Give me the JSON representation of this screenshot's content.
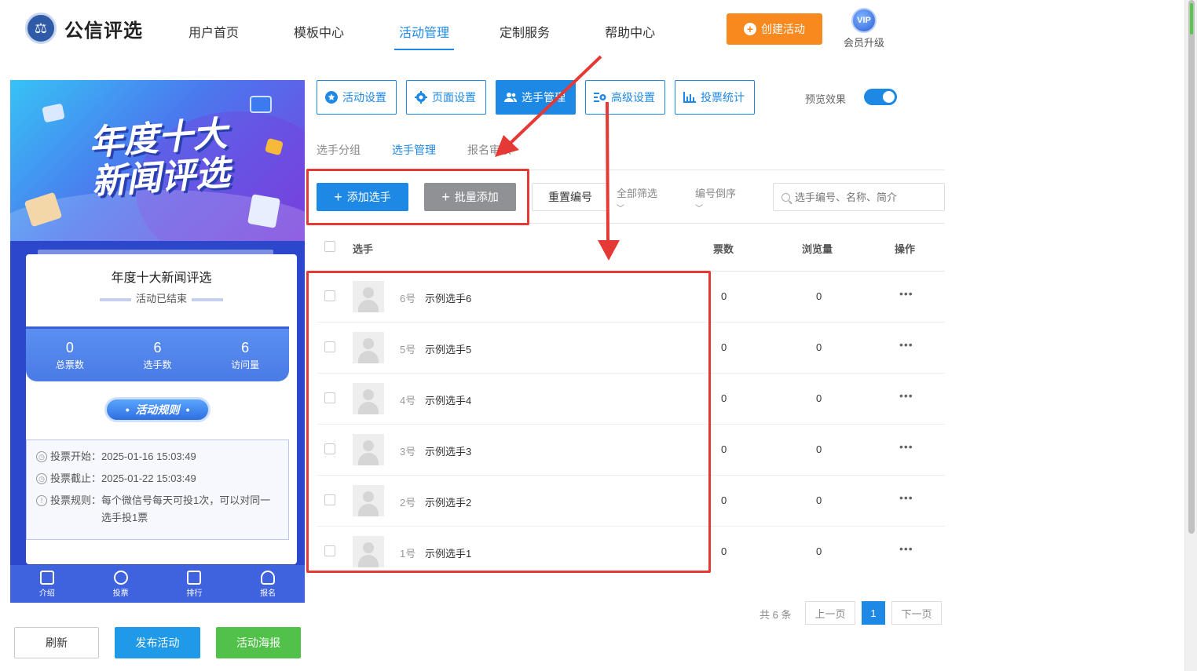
{
  "brand": {
    "name": "公信评选"
  },
  "nav": {
    "items": [
      "用户首页",
      "模板中心",
      "活动管理",
      "定制服务",
      "帮助中心"
    ],
    "active_index": 2,
    "create_label": "创建活动",
    "vip_badge": "VIP",
    "vip_label": "会员升级"
  },
  "preview": {
    "banner_title_line1": "年度十大",
    "banner_title_line2": "新闻评选",
    "title": "年度十大新闻评选",
    "status": "活动已结束",
    "stats": [
      {
        "value": "0",
        "label": "总票数"
      },
      {
        "value": "6",
        "label": "选手数"
      },
      {
        "value": "6",
        "label": "访问量"
      }
    ],
    "rules_label": "活动规则",
    "rules": [
      {
        "label": "投票开始：",
        "value": "2025-01-16 15:03:49"
      },
      {
        "label": "投票截止：",
        "value": "2025-01-22 15:03:49"
      },
      {
        "label": "投票规则：",
        "value": "每个微信号每天可投1次，可以对同一选手投1票"
      }
    ],
    "tabbar": [
      "介绍",
      "投票",
      "排行",
      "报名"
    ]
  },
  "bottom_buttons": {
    "refresh": "刷新",
    "publish": "发布活动",
    "poster": "活动海报"
  },
  "toolbar": {
    "buttons": [
      "活动设置",
      "页面设置",
      "选手管理",
      "高级设置",
      "投票统计"
    ],
    "active_index": 2,
    "preview_label": "预览效果",
    "preview_on": true
  },
  "subtabs": {
    "items": [
      "选手分组",
      "选手管理",
      "报名审核"
    ],
    "active_index": 1
  },
  "actions": {
    "add": "添加选手",
    "batch": "批量添加",
    "reset": "重置编号",
    "filter_all": "全部筛选",
    "sort_desc": "编号倒序",
    "search_placeholder": "选手编号、名称、简介"
  },
  "table": {
    "headers": {
      "player": "选手",
      "votes": "票数",
      "views": "浏览量",
      "ops": "操作"
    },
    "rows": [
      {
        "num": "6号",
        "name": "示例选手6",
        "votes": "0",
        "views": "0"
      },
      {
        "num": "5号",
        "name": "示例选手5",
        "votes": "0",
        "views": "0"
      },
      {
        "num": "4号",
        "name": "示例选手4",
        "votes": "0",
        "views": "0"
      },
      {
        "num": "3号",
        "name": "示例选手3",
        "votes": "0",
        "views": "0"
      },
      {
        "num": "2号",
        "name": "示例选手2",
        "votes": "0",
        "views": "0"
      },
      {
        "num": "1号",
        "name": "示例选手1",
        "votes": "0",
        "views": "0"
      }
    ],
    "more_glyph": "•••"
  },
  "pagination": {
    "total": "共 6 条",
    "prev": "上一页",
    "current": "1",
    "next": "下一页"
  },
  "colors": {
    "primary": "#1e88e5",
    "orange": "#f7891f",
    "green": "#52c14a",
    "annotation": "#e53935"
  }
}
